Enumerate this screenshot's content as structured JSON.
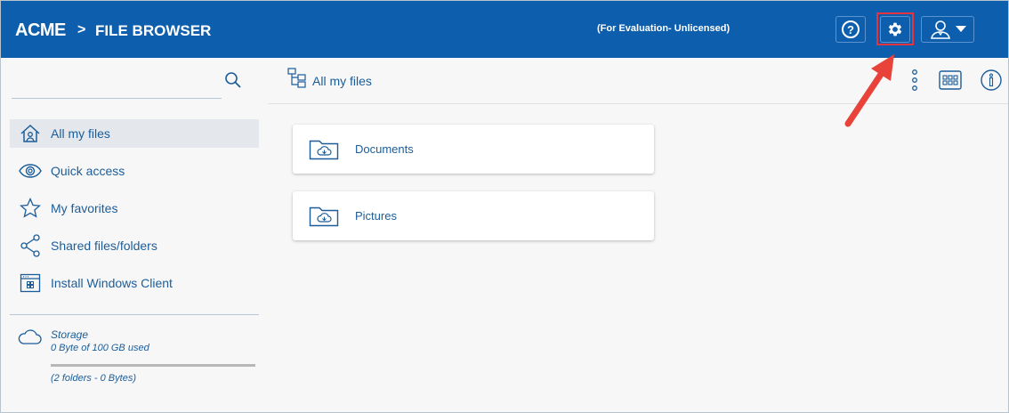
{
  "header": {
    "brand": "ACME",
    "separator": ">",
    "section": "FILE BROWSER",
    "license_status": "(For Evaluation- Unlicensed)",
    "help_label": "?"
  },
  "sidebar": {
    "items": [
      {
        "label": "All my files",
        "icon": "home-icon",
        "active": true
      },
      {
        "label": "Quick access",
        "icon": "eye-icon",
        "active": false
      },
      {
        "label": "My favorites",
        "icon": "star-icon",
        "active": false
      },
      {
        "label": "Shared files/folders",
        "icon": "share-icon",
        "active": false
      },
      {
        "label": "Install Windows Client",
        "icon": "windows-client-icon",
        "active": false
      }
    ],
    "storage": {
      "title": "Storage",
      "used": "0 Byte of 100 GB used",
      "used_fraction": 0,
      "summary": "(2 folders - 0 Bytes)"
    }
  },
  "main": {
    "breadcrumb": "All my files",
    "folders": [
      {
        "name": "Documents",
        "icon": "cloud-folder-icon"
      },
      {
        "name": "Pictures",
        "icon": "cloud-folder-icon"
      }
    ]
  },
  "colors": {
    "header_bg": "#0d5fae",
    "text_accent": "#1c5d99",
    "highlight": "#e53340"
  }
}
